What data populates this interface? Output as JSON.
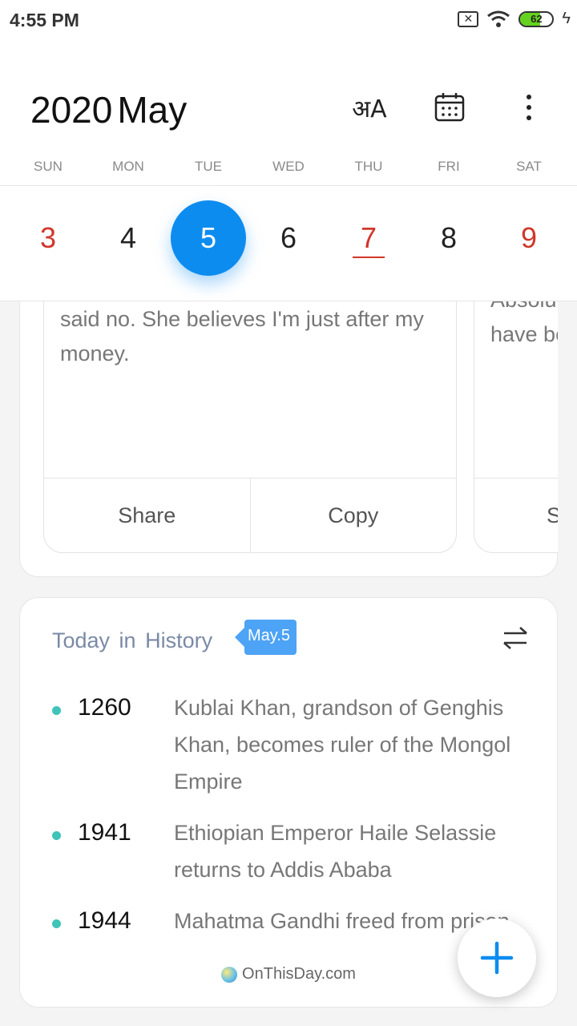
{
  "status_bar": {
    "time": "4:55 PM",
    "battery": "62",
    "battery_level": 0.62
  },
  "header": {
    "year": "2020",
    "month": "May",
    "icons": [
      "translate-icon",
      "calendar-icon",
      "more-icon"
    ]
  },
  "weekdays": [
    "SUN",
    "MON",
    "TUE",
    "WED",
    "THU",
    "FRI",
    "SAT"
  ],
  "dates": [
    {
      "num": "3",
      "style": "red"
    },
    {
      "num": "4",
      "style": "normal"
    },
    {
      "num": "5",
      "style": "selected"
    },
    {
      "num": "6",
      "style": "normal"
    },
    {
      "num": "7",
      "style": "red-underlined"
    },
    {
      "num": "8",
      "style": "normal"
    },
    {
      "num": "9",
      "style": "red"
    }
  ],
  "jokes": [
    {
      "text": "said no. She believes I'm just after my\nmoney.",
      "share": "Share",
      "copy": "Copy"
    },
    {
      "text": "an add\n-\nAbsolu\nhave be",
      "share": "S"
    }
  ],
  "history": {
    "title": "Today in History",
    "badge": "May.5",
    "events": [
      {
        "year": "1260",
        "desc": "Kublai Khan, grandson of Genghis Khan, becomes ruler of the Mongol Empire"
      },
      {
        "year": "1941",
        "desc": "Ethiopian Emperor Haile Selassie returns to Addis Ababa"
      },
      {
        "year": "1944",
        "desc": "Mahatma Gandhi freed from prison"
      }
    ],
    "source": "OnThisDay.com"
  },
  "colors": {
    "accent": "#0d8cf0",
    "weekend": "#d0372b",
    "event_dot": "#3ec4b8"
  }
}
